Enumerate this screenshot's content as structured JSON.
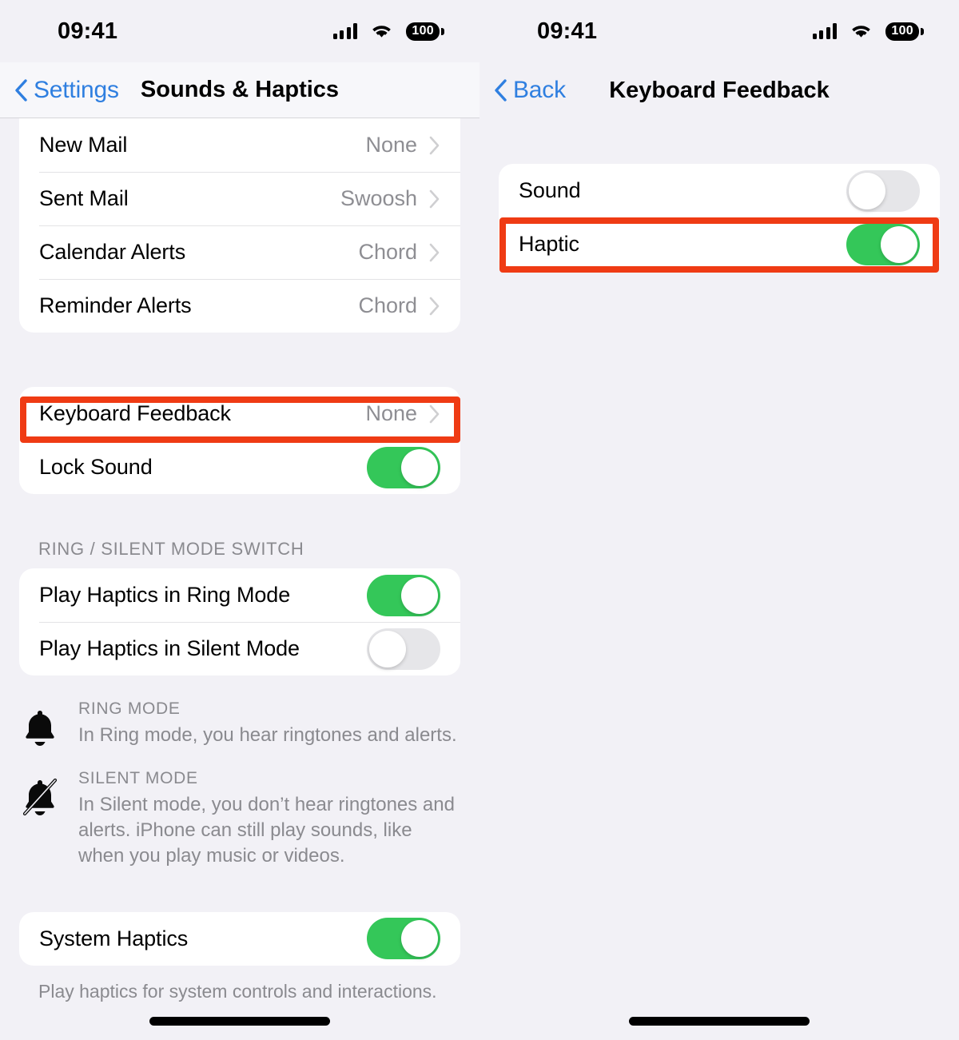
{
  "left": {
    "status": {
      "time": "09:41",
      "battery": "100",
      "signal_icon": "cellular-signal-icon",
      "wifi_icon": "wifi-icon",
      "battery_icon": "battery-icon"
    },
    "nav": {
      "back_label": "Settings",
      "title": "Sounds & Haptics",
      "back_icon": "chevron-left-icon"
    },
    "alert_rows": [
      {
        "label": "New Mail",
        "value": "None"
      },
      {
        "label": "Sent Mail",
        "value": "Swoosh"
      },
      {
        "label": "Calendar Alerts",
        "value": "Chord"
      },
      {
        "label": "Reminder Alerts",
        "value": "Chord"
      }
    ],
    "feedback_rows": [
      {
        "label": "Keyboard Feedback",
        "value": "None",
        "type": "disclosure",
        "highlighted": true
      },
      {
        "label": "Lock Sound",
        "value": "on",
        "type": "toggle"
      }
    ],
    "ring_section": {
      "header": "RING / SILENT MODE SWITCH",
      "rows": [
        {
          "label": "Play Haptics in Ring Mode",
          "value": "on"
        },
        {
          "label": "Play Haptics in Silent Mode",
          "value": "off"
        }
      ]
    },
    "info": [
      {
        "icon": "bell-icon",
        "title": "RING MODE",
        "body": "In Ring mode, you hear ringtones and alerts."
      },
      {
        "icon": "bell-slash-icon",
        "title": "SILENT MODE",
        "body": "In Silent mode, you don’t hear ringtones and alerts. iPhone can still play sounds, like when you play music or videos."
      }
    ],
    "system_haptics": {
      "label": "System Haptics",
      "value": "on"
    },
    "system_haptics_note": "Play haptics for system controls and interactions."
  },
  "right": {
    "status": {
      "time": "09:41",
      "battery": "100",
      "signal_icon": "cellular-signal-icon",
      "wifi_icon": "wifi-icon",
      "battery_icon": "battery-icon"
    },
    "nav": {
      "back_label": "Back",
      "title": "Keyboard Feedback",
      "back_icon": "chevron-left-icon"
    },
    "rows": [
      {
        "label": "Sound",
        "value": "off",
        "highlighted": false
      },
      {
        "label": "Haptic",
        "value": "on",
        "highlighted": true
      }
    ]
  },
  "colors": {
    "accent_blue": "#2f7fe0",
    "toggle_on_green": "#34c759",
    "toggle_off_gray": "#e6e6e9",
    "highlight_red": "#ef3b14",
    "background": "#f2f1f6",
    "secondary_text": "#8e8e93"
  }
}
